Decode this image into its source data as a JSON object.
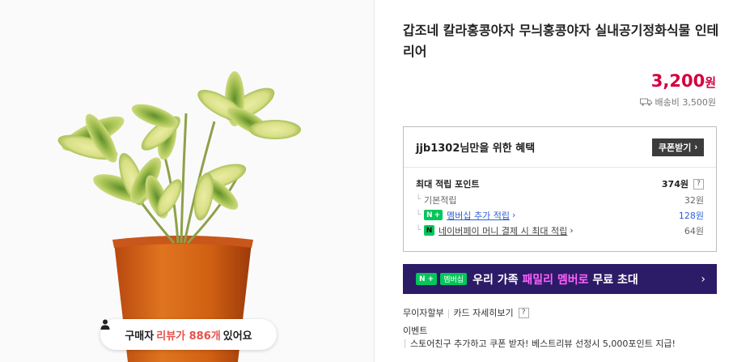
{
  "product": {
    "title": "갑조네 칼라홍콩야자 무늬홍콩야자 실내공기정화식물 인테리어",
    "price": "3,200",
    "price_unit": "원",
    "shipping": "배송비 3,500원"
  },
  "review_pill": {
    "prefix": "구매자",
    "highlight": "리뷰가 886개",
    "suffix": "있어요"
  },
  "benefit": {
    "title": "jjb1302님만을 위한 혜택",
    "coupon_button": "쿠폰받기",
    "max_points_label": "최대 적립 포인트",
    "max_points_value": "374원",
    "help_glyph": "?",
    "rows": [
      {
        "label": "기본적립",
        "value": "32원"
      },
      {
        "label": "멤버십 추가 적립",
        "value": "128원"
      },
      {
        "label": "네이버페이 머니 결제 시 최대 적립",
        "value": "64원"
      }
    ],
    "badge_np": "N",
    "badge_plus": "+",
    "badge_npay": "N"
  },
  "membership": {
    "badge1": "N +",
    "badge2": "멤버십",
    "text_before": "우리 가족",
    "text_accent": "패밀리 멤버로",
    "text_after": "무료 초대",
    "arrow": "›"
  },
  "card_info": {
    "installment": "무이자할부",
    "card_detail": "카드 자세히보기",
    "help_glyph": "?"
  },
  "event": {
    "label": "이벤트",
    "text": "스토어친구 추가하고 쿠폰 받자! 베스트리뷰 선정시 5,000포인트 지급!"
  },
  "colors": {
    "price_red": "#d4003d",
    "naver_green": "#03c75a",
    "banner_purple": "#2c1b66",
    "banner_accent": "#ff60ff",
    "review_highlight": "#e8514a",
    "link_blue": "#2d5fd8"
  },
  "icons": {
    "review": "person-icon",
    "shipping": "truck-icon",
    "coupon": "chevron-right-icon",
    "banner": "chevron-right-icon"
  }
}
